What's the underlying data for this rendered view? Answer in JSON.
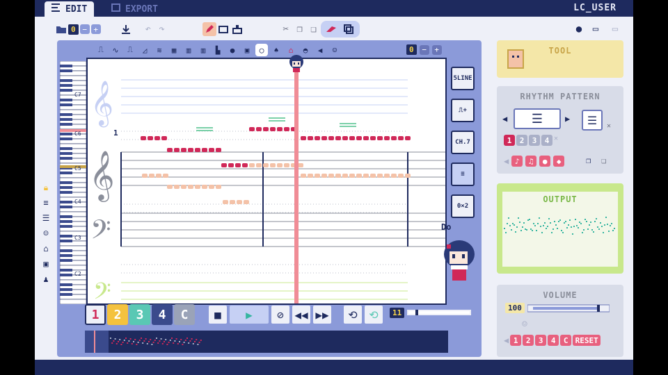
{
  "titlebar": {
    "tabs": [
      {
        "label": "EDIT",
        "icon": "edit-icon",
        "active": true
      },
      {
        "label": "EXPORT",
        "icon": "export-icon",
        "active": false
      }
    ],
    "user": "LC_USER"
  },
  "toolbar": {
    "file_count": "0"
  },
  "instrument_bar": {
    "value": "0"
  },
  "staff": {
    "measure_number": "1",
    "labels": [
      "C7",
      "C6",
      "C5",
      "C4",
      "C3",
      "C2"
    ]
  },
  "side_tools": {
    "line_label": "5LINE",
    "ch_label": "CH.7",
    "grid_label": "0×2"
  },
  "do_label": "Do",
  "tracks": [
    {
      "label": "1",
      "color": "#eef0f8",
      "text": "#d02858"
    },
    {
      "label": "2",
      "color": "#f4c23e",
      "text": "#ffffff"
    },
    {
      "label": "3",
      "color": "#5ac8b4",
      "text": "#ffffff"
    },
    {
      "label": "4",
      "color": "#3a4a8c",
      "text": "#ffffff"
    },
    {
      "label": "C",
      "color": "#9aa3b8",
      "text": "#ffffff"
    }
  ],
  "tempo_value": "11",
  "tool_panel": {
    "title": "TOOL"
  },
  "rhythm_panel": {
    "title": "RHYTHM PATTERN",
    "numbers": [
      "1",
      "2",
      "3",
      "4"
    ]
  },
  "output_panel": {
    "title": "OUTPUT"
  },
  "volume_panel": {
    "title": "VOLUME",
    "value": "100",
    "tracks": [
      "1",
      "2",
      "3",
      "4",
      "C"
    ],
    "reset_label": "RESET"
  },
  "colors": {
    "navy": "#1e2a5e",
    "accent_red": "#d02858",
    "playhead": "#f08c96",
    "tool_yellow": "#f4e7a8",
    "output_green": "#c8e88c"
  }
}
